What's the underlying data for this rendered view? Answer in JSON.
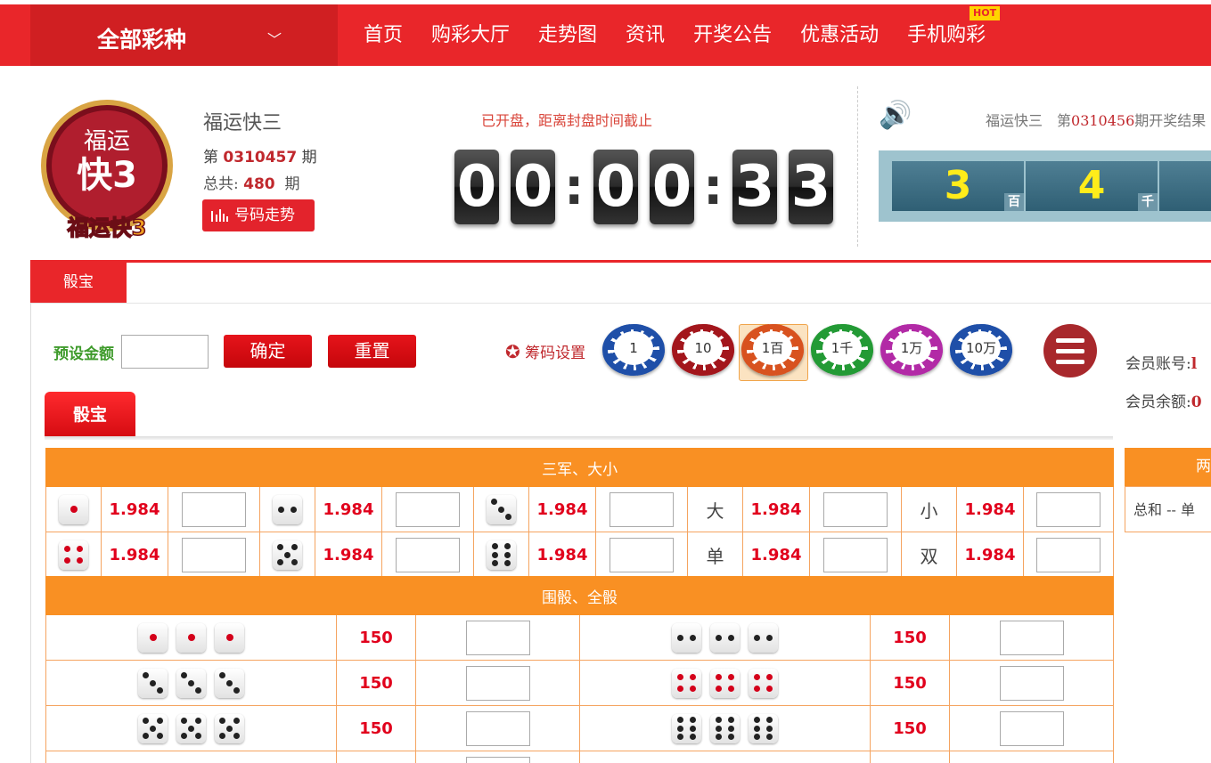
{
  "nav": {
    "all_lotteries": "全部彩种",
    "items": [
      "首页",
      "购彩大厅",
      "走势图",
      "资讯",
      "开奖公告",
      "优惠活动",
      "手机购彩"
    ],
    "hot_badge": "HOT"
  },
  "lottery": {
    "logo_text_top": "福运",
    "logo_text_mid": "快3",
    "logo_text_bottom": "福运快3",
    "name": "福运快三",
    "issue_prefix": "第",
    "issue": "0310457",
    "issue_suffix": "期",
    "total_label": "总共:",
    "total": "480",
    "total_suffix": "期",
    "trend_button": "号码走势"
  },
  "countdown": {
    "label": "已开盘，距离封盘时间截止",
    "digits": [
      "0",
      "0",
      "0",
      "0",
      "3",
      "3"
    ]
  },
  "last_result": {
    "text_prefix": "福运快三　第",
    "issue": "0310456",
    "text_suffix": "期开奖结果",
    "balls": [
      {
        "value": "3",
        "pos": "百"
      },
      {
        "value": "4",
        "pos": "千"
      }
    ]
  },
  "game_tab": "骰宝",
  "controls": {
    "preset_label": "预设金额",
    "preset_value": "",
    "confirm": "确定",
    "reset": "重置",
    "chip_settings": "筹码设置",
    "chips": [
      {
        "label": "1",
        "color": "#1f4fa8"
      },
      {
        "label": "10",
        "color": "#a3161c"
      },
      {
        "label": "1百",
        "color": "#d8521f"
      },
      {
        "label": "1千",
        "color": "#239a35"
      },
      {
        "label": "1万",
        "color": "#b22aa6"
      },
      {
        "label": "10万",
        "color": "#1f4fa8"
      }
    ],
    "selected_chip": "1百"
  },
  "account": {
    "account_label": "会员账号:",
    "account_value": "l",
    "balance_label": "会员余额:",
    "balance_value": "0"
  },
  "sub_tab": "骰宝",
  "section1": {
    "title": "三军、大小",
    "rows": [
      [
        {
          "die": 1,
          "odds": "1.984"
        },
        {
          "die": 2,
          "odds": "1.984"
        },
        {
          "die": 3,
          "odds": "1.984"
        },
        {
          "text": "大",
          "odds": "1.984"
        },
        {
          "text": "小",
          "odds": "1.984"
        }
      ],
      [
        {
          "die": 4,
          "odds": "1.984"
        },
        {
          "die": 5,
          "odds": "1.984"
        },
        {
          "die": 6,
          "odds": "1.984"
        },
        {
          "text": "单",
          "odds": "1.984"
        },
        {
          "text": "双",
          "odds": "1.984"
        }
      ]
    ]
  },
  "section2": {
    "title": "围骰、全骰",
    "rows": [
      [
        {
          "die": 1,
          "odds": "150"
        },
        {
          "die": 2,
          "odds": "150"
        }
      ],
      [
        {
          "die": 3,
          "odds": "150"
        },
        {
          "die": 4,
          "odds": "150"
        }
      ],
      [
        {
          "die": 5,
          "odds": "150"
        },
        {
          "die": 6,
          "odds": "150"
        }
      ]
    ]
  },
  "side_table": {
    "title": "两面",
    "row_text": "总和 -- 单"
  }
}
